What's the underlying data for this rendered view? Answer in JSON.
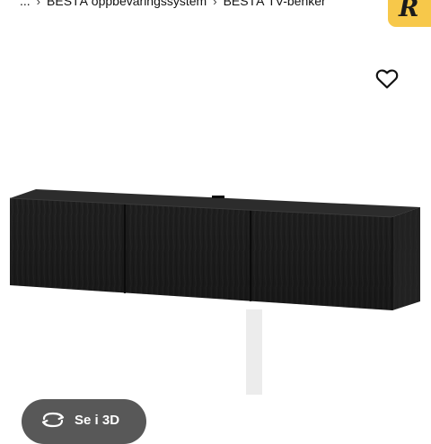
{
  "breadcrumb": {
    "ellipsis": "...",
    "items": [
      "BESTÅ oppbevaringssystem",
      "BESTÅ TV-benker"
    ]
  },
  "app_badge": {
    "letter": "R",
    "color": "#f7c84a"
  },
  "favorite": {
    "icon": "heart-outline-icon"
  },
  "product_image": {
    "description_color": "#1e1e1e",
    "shadow_color": "#e6e6e6"
  },
  "view3d": {
    "label": "Se i 3D",
    "icon": "rotate-3d-icon",
    "bg_color": "#585858"
  }
}
